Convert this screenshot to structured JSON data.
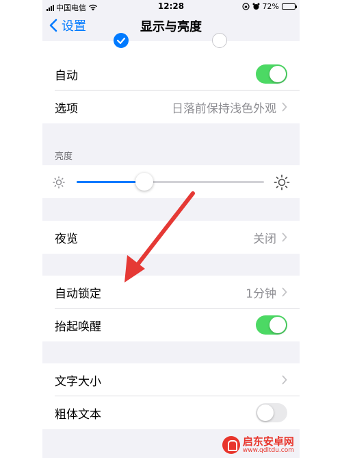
{
  "status_bar": {
    "carrier": "中国电信",
    "time": "12:28",
    "battery_percent": "72%",
    "battery_level": 0.72
  },
  "nav": {
    "back_label": "设置",
    "title": "显示与亮度"
  },
  "appearance": {
    "selected": "light"
  },
  "appearance_rows": {
    "auto_label": "自动",
    "auto_on": true,
    "options_label": "选项",
    "options_value": "日落前保持浅色外观"
  },
  "brightness": {
    "section_label": "亮度",
    "level": 0.36
  },
  "night_shift": {
    "label": "夜览",
    "value": "关闭"
  },
  "lock_group": {
    "auto_lock_label": "自动锁定",
    "auto_lock_value": "1分钟",
    "raise_to_wake_label": "抬起唤醒",
    "raise_to_wake_on": true
  },
  "text_group": {
    "text_size_label": "文字大小",
    "bold_text_label": "粗体文本",
    "bold_text_on": false
  },
  "colors": {
    "accent": "#007aff",
    "toggle_on": "#4cd964",
    "annotation_arrow": "#e53935"
  },
  "watermark": {
    "name": "启东安卓网",
    "url": "www.qdltdu.com"
  }
}
